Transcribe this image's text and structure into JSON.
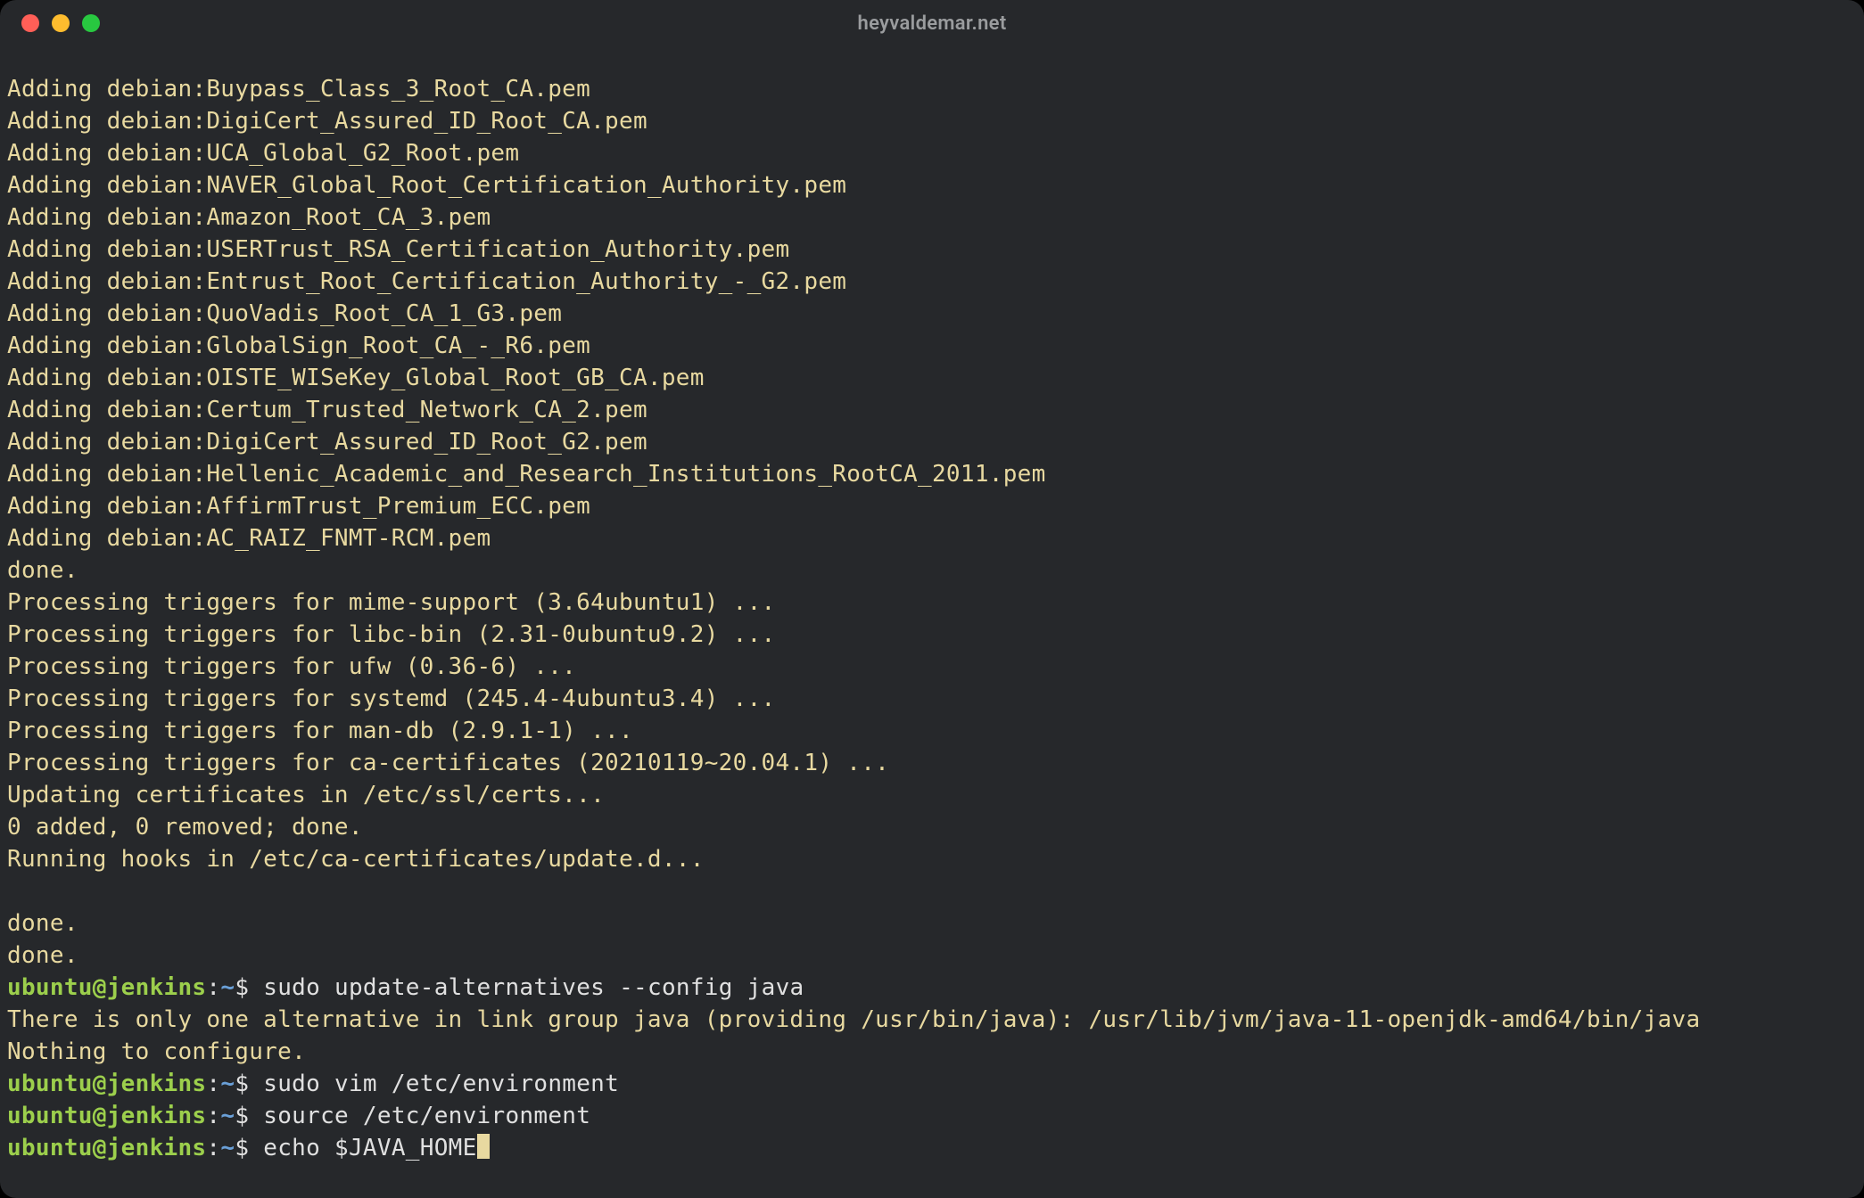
{
  "window": {
    "title": "heyvaldemar.net",
    "traffic_lights": {
      "close_color": "#ff5f57",
      "min_color": "#febc2e",
      "max_color": "#28c840"
    }
  },
  "colors": {
    "bg": "#26282b",
    "text_yellow": "#e8d9a0",
    "prompt_green": "#9ccf4c",
    "path_blue": "#6aa0d8",
    "cmd_white": "#e0e0e0"
  },
  "prompt": {
    "user": "ubuntu",
    "at": "@",
    "host": "jenkins",
    "colon": ":",
    "path": "~",
    "dollar": "$"
  },
  "output_lines": [
    "Adding debian:Buypass_Class_3_Root_CA.pem",
    "Adding debian:DigiCert_Assured_ID_Root_CA.pem",
    "Adding debian:UCA_Global_G2_Root.pem",
    "Adding debian:NAVER_Global_Root_Certification_Authority.pem",
    "Adding debian:Amazon_Root_CA_3.pem",
    "Adding debian:USERTrust_RSA_Certification_Authority.pem",
    "Adding debian:Entrust_Root_Certification_Authority_-_G2.pem",
    "Adding debian:QuoVadis_Root_CA_1_G3.pem",
    "Adding debian:GlobalSign_Root_CA_-_R6.pem",
    "Adding debian:OISTE_WISeKey_Global_Root_GB_CA.pem",
    "Adding debian:Certum_Trusted_Network_CA_2.pem",
    "Adding debian:DigiCert_Assured_ID_Root_G2.pem",
    "Adding debian:Hellenic_Academic_and_Research_Institutions_RootCA_2011.pem",
    "Adding debian:AffirmTrust_Premium_ECC.pem",
    "Adding debian:AC_RAIZ_FNMT-RCM.pem",
    "done.",
    "Processing triggers for mime-support (3.64ubuntu1) ...",
    "Processing triggers for libc-bin (2.31-0ubuntu9.2) ...",
    "Processing triggers for ufw (0.36-6) ...",
    "Processing triggers for systemd (245.4-4ubuntu3.4) ...",
    "Processing triggers for man-db (2.9.1-1) ...",
    "Processing triggers for ca-certificates (20210119~20.04.1) ...",
    "Updating certificates in /etc/ssl/certs...",
    "0 added, 0 removed; done.",
    "Running hooks in /etc/ca-certificates/update.d...",
    "",
    "done.",
    "done."
  ],
  "commands": [
    {
      "cmd": "sudo update-alternatives --config java",
      "output": [
        "There is only one alternative in link group java (providing /usr/bin/java): /usr/lib/jvm/java-11-openjdk-amd64/bin/java",
        "Nothing to configure."
      ]
    },
    {
      "cmd": "sudo vim /etc/environment",
      "output": []
    },
    {
      "cmd": "source /etc/environment",
      "output": []
    },
    {
      "cmd": "echo $JAVA_HOME",
      "output": [],
      "cursor_after": true
    }
  ]
}
